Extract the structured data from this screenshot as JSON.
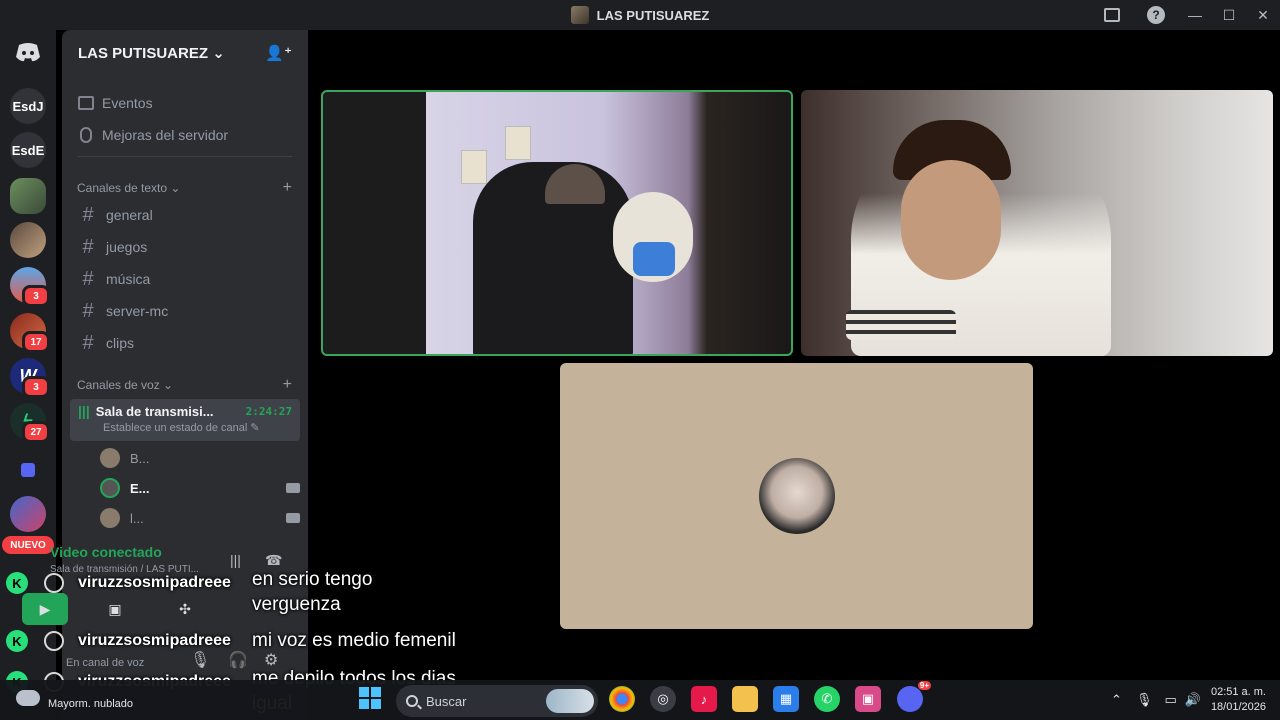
{
  "window": {
    "title": "LAS PUTISUAREZ",
    "help_icon": "?",
    "minimize": "—",
    "maximize": "☐",
    "close": "✕"
  },
  "server_rail": {
    "items": [
      {
        "label": "EsdJ"
      },
      {
        "label": "EsdE"
      },
      {
        "badge": "3"
      },
      {
        "badge": "17"
      },
      {
        "badge": "3"
      },
      {
        "badge": "27"
      }
    ],
    "nuevo_label": "NUEVO"
  },
  "guild": {
    "name": "LAS PUTISUAREZ",
    "menu_items": [
      "Eventos",
      "Mejoras del servidor"
    ],
    "text_category": "Canales de texto",
    "text_channels": [
      "general",
      "juegos",
      "música",
      "server-mc",
      "clips"
    ],
    "voice_category": "Canales de voz",
    "active_voice": {
      "name": "Sala de transmisi...",
      "timer": "2:24:27",
      "status": "Establece un estado de canal"
    },
    "voice_users": [
      "B...",
      "E...",
      "l..."
    ]
  },
  "voice_panel": {
    "status": "Video conectado",
    "location": "Sala de transmisión / LAS PUTI...",
    "user_status": "En canal de voz"
  },
  "subtitles": [
    {
      "badge": "K",
      "user": "viruzzsosmipadreee",
      "lines": [
        "en serio tengo",
        "verguenza"
      ]
    },
    {
      "badge": "K",
      "user": "viruzzsosmipadreee",
      "lines": [
        "mi voz es medio femenil"
      ]
    },
    {
      "badge": "K",
      "user": "viruzzsosmipadreee",
      "lines": [
        "me depilo todos los dias",
        "igual"
      ]
    }
  ],
  "taskbar": {
    "weather": "Mayorm. nublado",
    "search_placeholder": "Buscar",
    "discord_badge": "9+",
    "time": "02:51 a. m.",
    "date": "18/01/2026"
  },
  "colors": {
    "speaking_border": "#3ba55c",
    "accent_green": "#23a559",
    "badge_red": "#f23f43",
    "blurple": "#5865f2"
  }
}
